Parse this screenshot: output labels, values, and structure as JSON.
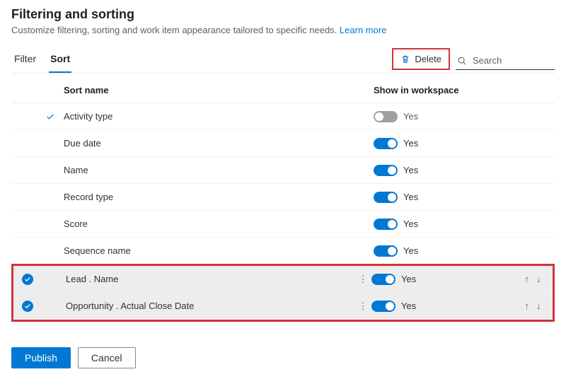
{
  "header": {
    "title": "Filtering and sorting",
    "subtitle": "Customize filtering, sorting and work item appearance tailored to specific needs.",
    "learn_more": "Learn more"
  },
  "tabs": {
    "filter": "Filter",
    "sort": "Sort"
  },
  "commands": {
    "delete": "Delete"
  },
  "search": {
    "placeholder": "Search"
  },
  "columns": {
    "sort_name": "Sort name",
    "show_in_workspace": "Show in workspace"
  },
  "rows": [
    {
      "name": "Activity type",
      "selected": false,
      "checkmark": true,
      "more": false,
      "toggle_on": false,
      "toggle_label": "Yes",
      "arrows": false
    },
    {
      "name": "Due date",
      "selected": false,
      "checkmark": false,
      "more": false,
      "toggle_on": true,
      "toggle_label": "Yes",
      "arrows": false
    },
    {
      "name": "Name",
      "selected": false,
      "checkmark": false,
      "more": false,
      "toggle_on": true,
      "toggle_label": "Yes",
      "arrows": false
    },
    {
      "name": "Record type",
      "selected": false,
      "checkmark": false,
      "more": false,
      "toggle_on": true,
      "toggle_label": "Yes",
      "arrows": false
    },
    {
      "name": "Score",
      "selected": false,
      "checkmark": false,
      "more": false,
      "toggle_on": true,
      "toggle_label": "Yes",
      "arrows": false
    },
    {
      "name": "Sequence name",
      "selected": false,
      "checkmark": false,
      "more": false,
      "toggle_on": true,
      "toggle_label": "Yes",
      "arrows": false
    },
    {
      "name": "Lead . Name",
      "selected": true,
      "checkmark": false,
      "more": true,
      "toggle_on": true,
      "toggle_label": "Yes",
      "arrows": true
    },
    {
      "name": "Opportunity . Actual Close Date",
      "selected": true,
      "checkmark": false,
      "more": true,
      "toggle_on": true,
      "toggle_label": "Yes",
      "arrows": true
    }
  ],
  "footer": {
    "publish": "Publish",
    "cancel": "Cancel"
  }
}
